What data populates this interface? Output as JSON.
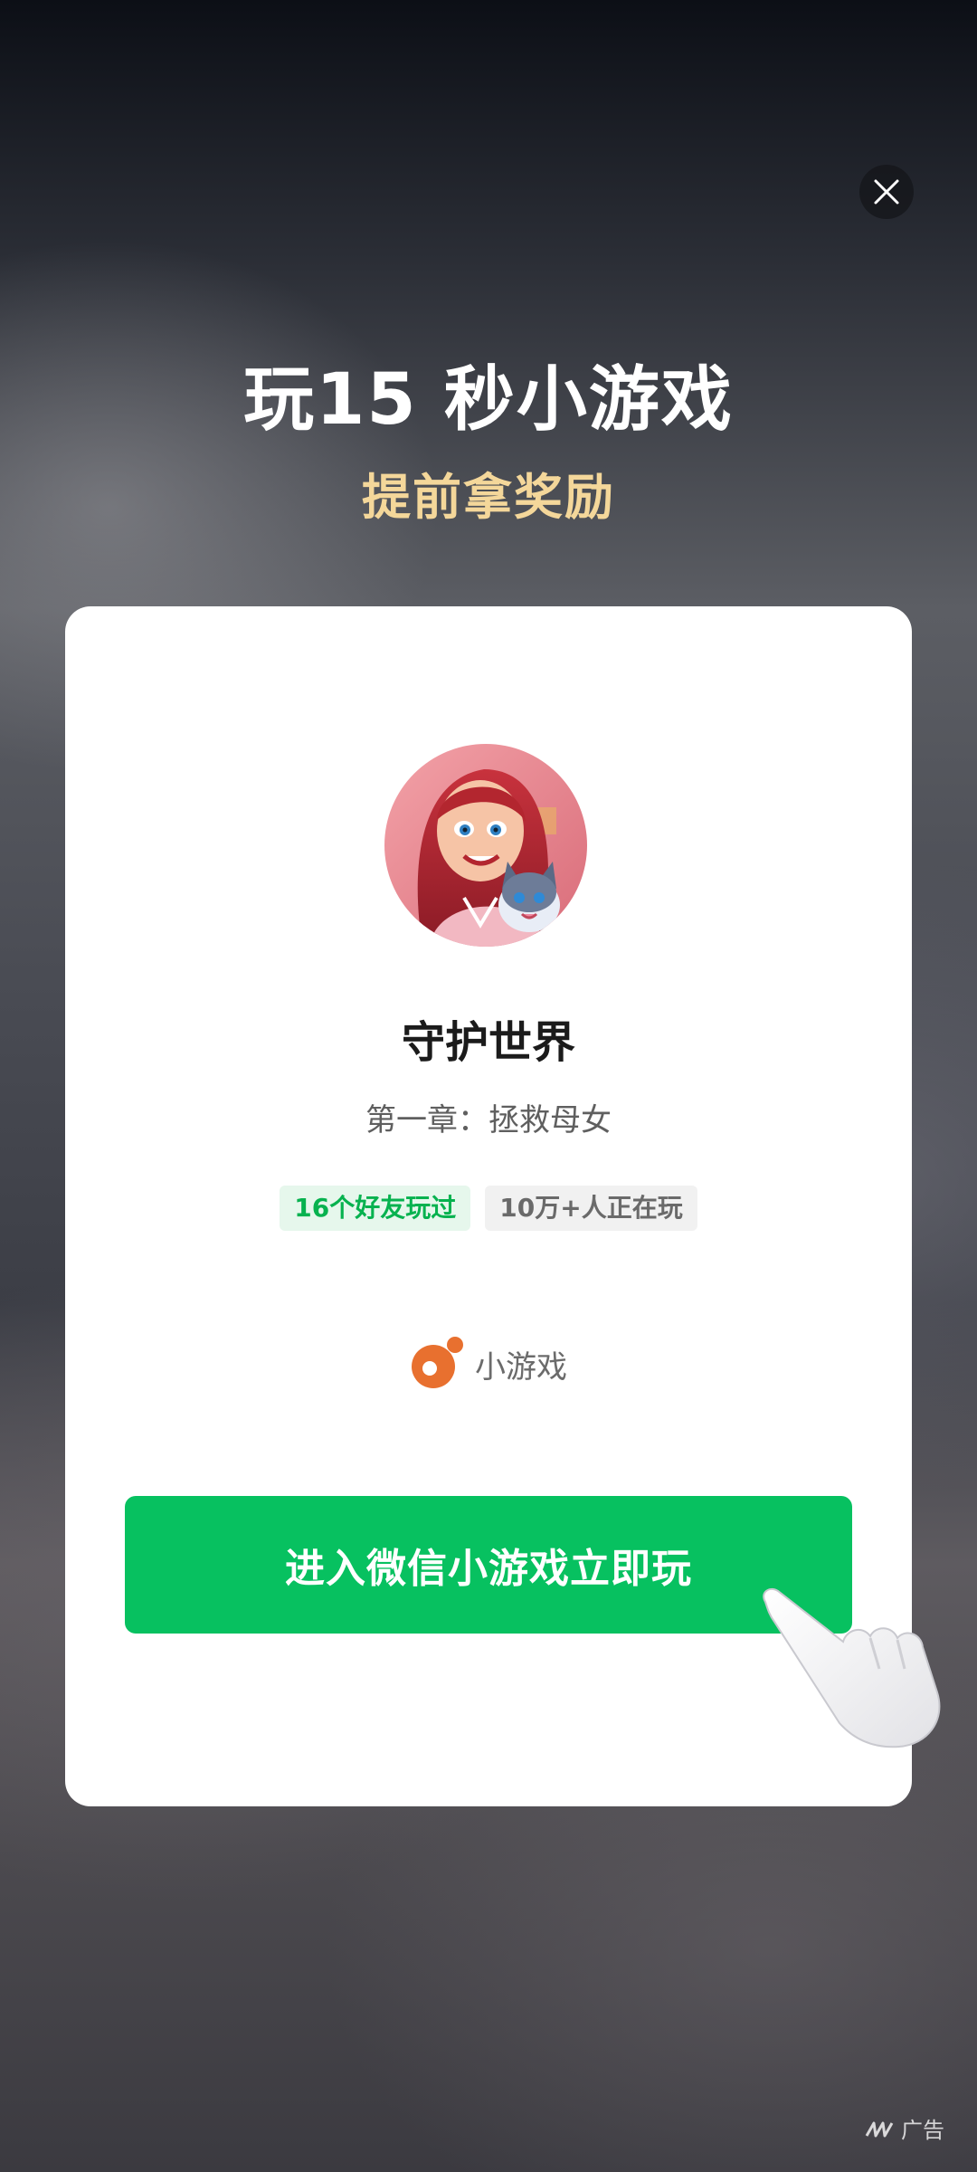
{
  "headline": "玩15 秒小游戏",
  "subheadline": "提前拿奖励",
  "card": {
    "game_title": "守护世界",
    "game_subtitle": "第一章：拯救母女",
    "tags": {
      "friends": "16个好友玩过",
      "players": "10万+人正在玩"
    },
    "brand_label": "小游戏",
    "cta_label": "进入微信小游戏立即玩"
  },
  "ad_label": "广告",
  "icons": {
    "close": "close-icon",
    "brand": "mini-game-logo-icon",
    "pointer": "pointing-hand-icon",
    "ad": "ad-brand-icon"
  },
  "colors": {
    "accent_green": "#07c160",
    "headline_gold": "#f4d79a",
    "friends_tag_text": "#07b24f"
  }
}
